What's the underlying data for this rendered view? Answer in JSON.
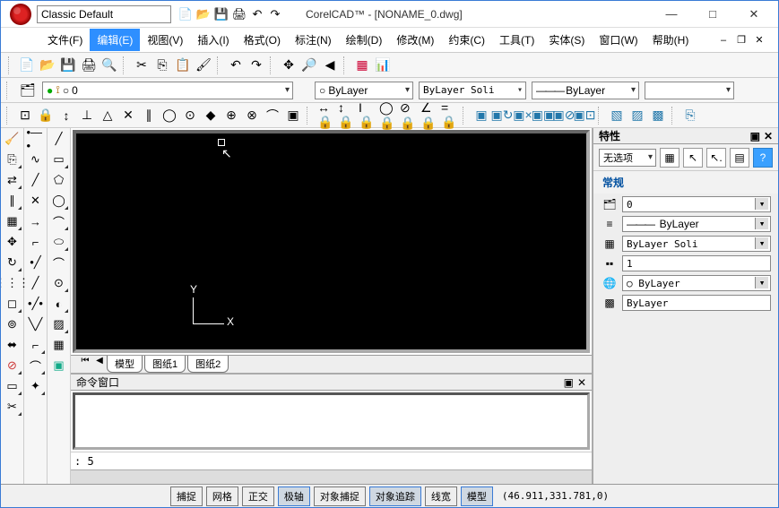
{
  "title": "CorelCAD™ - [NONAME_0.dwg]",
  "workspace": "Classic Default",
  "menus": [
    "文件(F)",
    "编辑(E)",
    "视图(V)",
    "插入(I)",
    "格式(O)",
    "标注(N)",
    "绘制(D)",
    "修改(M)",
    "约束(C)",
    "工具(T)",
    "实体(S)",
    "窗口(W)",
    "帮助(H)"
  ],
  "active_menu_index": 1,
  "layer_row": {
    "layer_name": "0"
  },
  "color_drop": "ByLayer",
  "linetype_drop": "ByLayer   Soli",
  "lineweight_drop": "ByLayer",
  "model_tabs": [
    "模型",
    "图纸1",
    "图纸2"
  ],
  "cmd_window_title": "命令窗口",
  "cmd_prompt": ": 5",
  "props_panel": {
    "title": "特性",
    "selection": "无选项",
    "section_general": "常规",
    "rows": {
      "layer": "0",
      "linetype": "ByLayer",
      "style": "ByLayer   Soli",
      "scale": "1",
      "color": "○ ByLayer",
      "material": "ByLayer"
    }
  },
  "status": {
    "buttons": [
      "捕捉",
      "网格",
      "正交",
      "极轴",
      "对象捕捉",
      "对象追踪",
      "线宽",
      "模型"
    ],
    "active": [
      3,
      5,
      7
    ],
    "coords": "(46.911,331.781,0)"
  },
  "bylayer_circle": "○"
}
